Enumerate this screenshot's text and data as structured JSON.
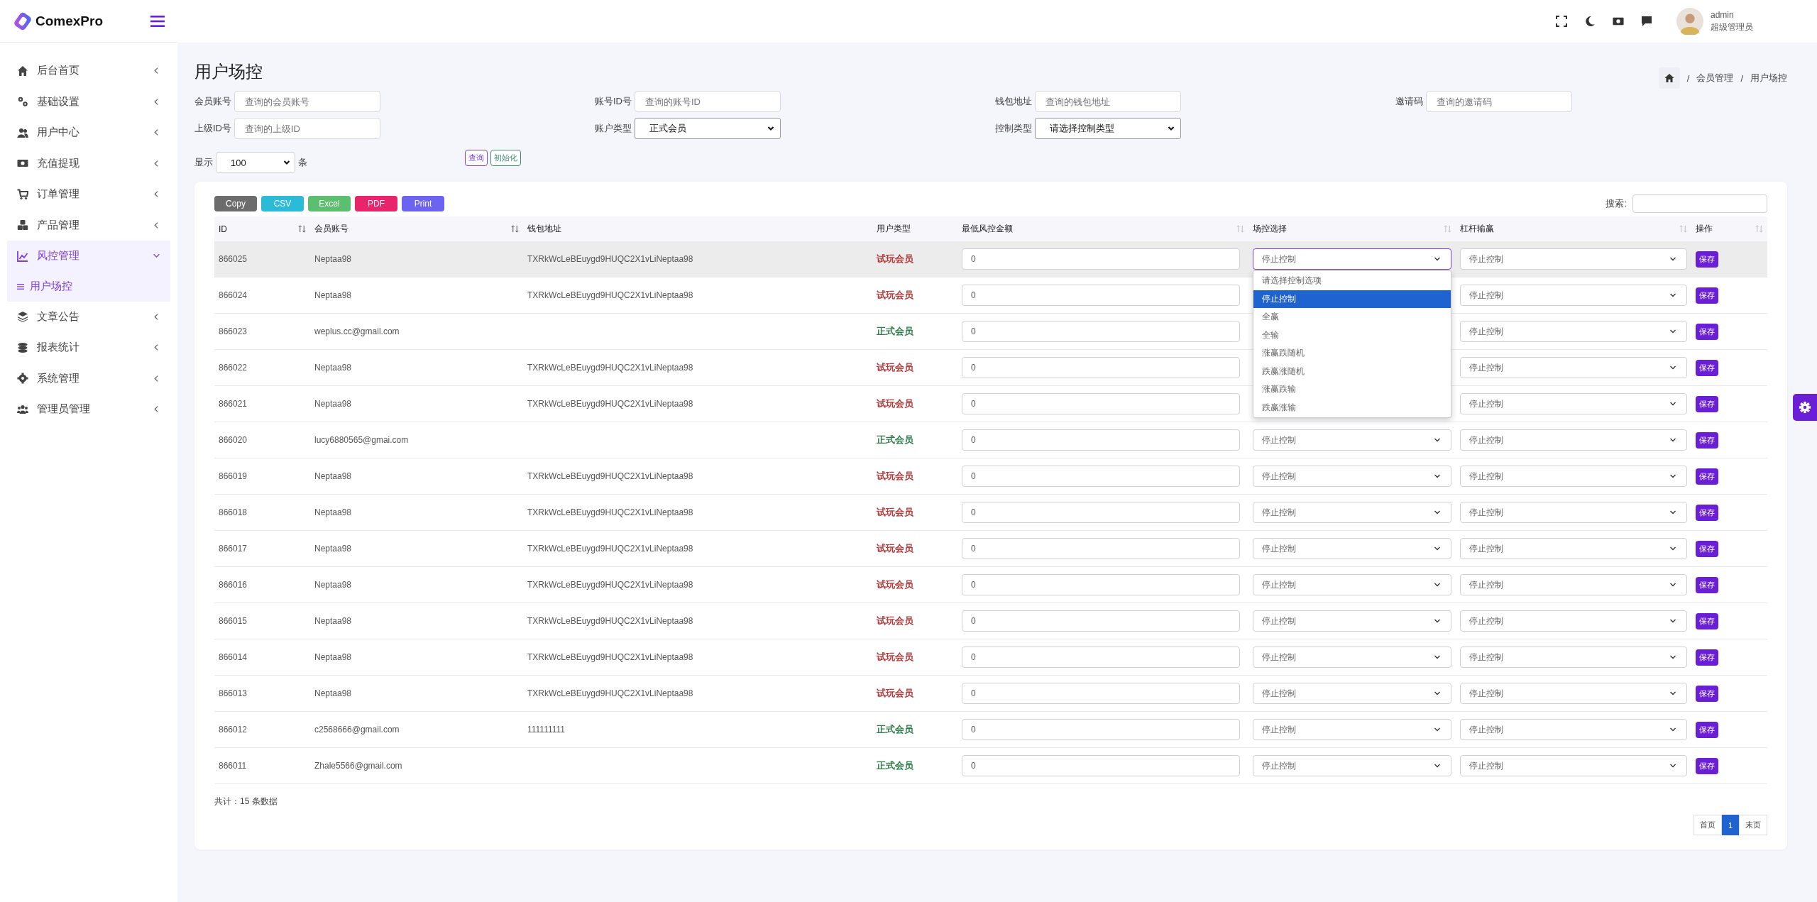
{
  "brand": {
    "name": "ComexPro"
  },
  "header": {
    "user": {
      "name": "admin",
      "role": "超级管理员"
    }
  },
  "sidebar": {
    "items": [
      {
        "label": "后台首页",
        "expanded": false
      },
      {
        "label": "基础设置",
        "expanded": false
      },
      {
        "label": "用户中心",
        "expanded": false
      },
      {
        "label": "充值提现",
        "expanded": false
      },
      {
        "label": "订单管理",
        "expanded": false
      },
      {
        "label": "产品管理",
        "expanded": false
      },
      {
        "label": "风控管理",
        "expanded": true,
        "children": [
          {
            "label": "用户场控",
            "selected": true
          }
        ]
      },
      {
        "label": "文章公告",
        "expanded": false
      },
      {
        "label": "报表统计",
        "expanded": false
      },
      {
        "label": "系统管理",
        "expanded": false
      },
      {
        "label": "管理员管理",
        "expanded": false
      }
    ]
  },
  "page": {
    "title": "用户场控",
    "breadcrumb": [
      {
        "separator": "/",
        "label": "会员管理"
      },
      {
        "separator": "/",
        "label": "用户场控"
      }
    ]
  },
  "filters": [
    {
      "label": "会员账号",
      "kind": "input",
      "placeholder": "查询的会员账号"
    },
    {
      "label": "账号ID号",
      "kind": "input",
      "placeholder": "查询的账号ID"
    },
    {
      "label": "钱包地址",
      "kind": "input",
      "placeholder": "查询的钱包地址"
    },
    {
      "label": "邀请码",
      "kind": "input",
      "placeholder": "查询的邀请码"
    },
    {
      "label": "上级ID号",
      "kind": "input",
      "placeholder": "查询的上级ID"
    },
    {
      "label": "账户类型",
      "kind": "select",
      "value": "正式会员"
    },
    {
      "label": "控制类型",
      "kind": "select",
      "value": "请选择控制类型"
    }
  ],
  "page_size": {
    "label_before": "显示",
    "value": "100",
    "label_after": "条"
  },
  "actions": [
    {
      "label": "查询",
      "kind": "query"
    },
    {
      "label": "初始化",
      "kind": "reset"
    }
  ],
  "export_buttons": [
    {
      "label": "Copy",
      "kind": "copy"
    },
    {
      "label": "CSV",
      "kind": "csv"
    },
    {
      "label": "Excel",
      "kind": "excel"
    },
    {
      "label": "PDF",
      "kind": "pdf"
    },
    {
      "label": "Print",
      "kind": "print"
    }
  ],
  "search": {
    "label": "搜索:"
  },
  "table": {
    "columns": [
      {
        "label": "ID",
        "sortable": true
      },
      {
        "label": "会员账号",
        "sortable": true
      },
      {
        "label": "钱包地址",
        "sortable": false
      },
      {
        "label": "用户类型",
        "sortable": false
      },
      {
        "label": "最低风控金额",
        "sortable": true
      },
      {
        "label": "场控选择",
        "sortable": true
      },
      {
        "label": "杠杆输赢",
        "sortable": true
      },
      {
        "label": "操作",
        "sortable": true
      }
    ],
    "rows": [
      {
        "id": "866025",
        "account": "Neptaa98",
        "wallet": "TXRkWcLeBEuygd9HUQC2X1vLiNeptaa98",
        "type": "试玩会员",
        "color": "#b23a3a",
        "min_amount": "0",
        "control": "停止控制",
        "leverage": "停止控制",
        "action": "保存",
        "selected": true,
        "control_options": [
          {
            "label": "请选择控制选项",
            "selected": false
          },
          {
            "label": "停止控制",
            "selected": true
          },
          {
            "label": "全赢",
            "selected": false
          },
          {
            "label": "全输",
            "selected": false
          },
          {
            "label": "涨赢跌随机",
            "selected": false
          },
          {
            "label": "跌赢涨随机",
            "selected": false
          },
          {
            "label": "涨赢跌输",
            "selected": false
          },
          {
            "label": "跌赢涨输",
            "selected": false
          }
        ]
      },
      {
        "id": "866024",
        "account": "Neptaa98",
        "wallet": "TXRkWcLeBEuygd9HUQC2X1vLiNeptaa98",
        "type": "试玩会员",
        "color": "#b23a3a",
        "min_amount": "0",
        "leverage": "停止控制",
        "action": "保存",
        "selected": false
      },
      {
        "id": "866023",
        "account": "weplus.cc@gmail.com",
        "type": "正式会员",
        "color": "#2e7d4a",
        "min_amount": "0",
        "leverage": "停止控制",
        "action": "保存",
        "selected": false
      },
      {
        "id": "866022",
        "account": "Neptaa98",
        "wallet": "TXRkWcLeBEuygd9HUQC2X1vLiNeptaa98",
        "type": "试玩会员",
        "color": "#b23a3a",
        "min_amount": "0",
        "leverage": "停止控制",
        "action": "保存",
        "selected": false
      },
      {
        "id": "866021",
        "account": "Neptaa98",
        "wallet": "TXRkWcLeBEuygd9HUQC2X1vLiNeptaa98",
        "type": "试玩会员",
        "color": "#b23a3a",
        "min_amount": "0",
        "leverage": "停止控制",
        "action": "保存",
        "selected": false
      },
      {
        "id": "866020",
        "account": "lucy6880565@gmai.com",
        "type": "正式会员",
        "color": "#2e7d4a",
        "min_amount": "0",
        "control": "停止控制",
        "leverage": "停止控制",
        "action": "保存",
        "selected": false
      },
      {
        "id": "866019",
        "account": "Neptaa98",
        "wallet": "TXRkWcLeBEuygd9HUQC2X1vLiNeptaa98",
        "type": "试玩会员",
        "color": "#b23a3a",
        "min_amount": "0",
        "control": "停止控制",
        "leverage": "停止控制",
        "action": "保存",
        "selected": false
      },
      {
        "id": "866018",
        "account": "Neptaa98",
        "wallet": "TXRkWcLeBEuygd9HUQC2X1vLiNeptaa98",
        "type": "试玩会员",
        "color": "#b23a3a",
        "min_amount": "0",
        "control": "停止控制",
        "leverage": "停止控制",
        "action": "保存",
        "selected": false
      },
      {
        "id": "866017",
        "account": "Neptaa98",
        "wallet": "TXRkWcLeBEuygd9HUQC2X1vLiNeptaa98",
        "type": "试玩会员",
        "color": "#b23a3a",
        "min_amount": "0",
        "control": "停止控制",
        "leverage": "停止控制",
        "action": "保存",
        "selected": false
      },
      {
        "id": "866016",
        "account": "Neptaa98",
        "wallet": "TXRkWcLeBEuygd9HUQC2X1vLiNeptaa98",
        "type": "试玩会员",
        "color": "#b23a3a",
        "min_amount": "0",
        "control": "停止控制",
        "leverage": "停止控制",
        "action": "保存",
        "selected": false
      },
      {
        "id": "866015",
        "account": "Neptaa98",
        "wallet": "TXRkWcLeBEuygd9HUQC2X1vLiNeptaa98",
        "type": "试玩会员",
        "color": "#b23a3a",
        "min_amount": "0",
        "control": "停止控制",
        "leverage": "停止控制",
        "action": "保存",
        "selected": false
      },
      {
        "id": "866014",
        "account": "Neptaa98",
        "wallet": "TXRkWcLeBEuygd9HUQC2X1vLiNeptaa98",
        "type": "试玩会员",
        "color": "#b23a3a",
        "min_amount": "0",
        "control": "停止控制",
        "leverage": "停止控制",
        "action": "保存",
        "selected": false
      },
      {
        "id": "866013",
        "account": "Neptaa98",
        "wallet": "TXRkWcLeBEuygd9HUQC2X1vLiNeptaa98",
        "type": "试玩会员",
        "color": "#b23a3a",
        "min_amount": "0",
        "control": "停止控制",
        "leverage": "停止控制",
        "action": "保存",
        "selected": false
      },
      {
        "id": "866012",
        "account": "c2568666@gmail.com",
        "wallet": "111111111",
        "type": "正式会员",
        "color": "#2e7d4a",
        "min_amount": "0",
        "control": "停止控制",
        "leverage": "停止控制",
        "action": "保存",
        "selected": false
      },
      {
        "id": "866011",
        "account": "Zhale5566@gmail.com",
        "type": "正式会员",
        "color": "#2e7d4a",
        "min_amount": "0",
        "control": "停止控制",
        "leverage": "停止控制",
        "action": "保存",
        "selected": false
      }
    ]
  },
  "total": "共计：15 条数据",
  "pagination": [
    {
      "label": "首页",
      "selected": false
    },
    {
      "label": "1",
      "selected": true
    },
    {
      "label": "末页",
      "selected": false
    }
  ]
}
